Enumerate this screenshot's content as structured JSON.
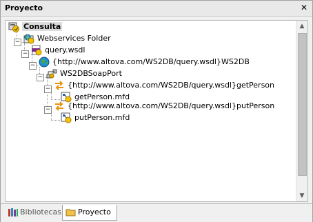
{
  "panel": {
    "title": "Proyecto",
    "close_glyph": "✕"
  },
  "tree": {
    "root": {
      "label": "Consulta",
      "icon": "project-icon"
    },
    "folder": {
      "label": "Webservices Folder",
      "icon": "webservices-folder-icon"
    },
    "wsdl": {
      "label": "query.wsdl",
      "icon": "wsdl-file-icon"
    },
    "service": {
      "label": "{http://www.altova.com/WS2DB/query.wsdl}WS2DB",
      "icon": "globe-service-icon"
    },
    "port": {
      "label": "WS2DBSoapPort",
      "icon": "soap-port-icon"
    },
    "operations": [
      {
        "label": "{http://www.altova.com/WS2DB/query.wsdl}getPerson",
        "icon": "operation-arrows-icon",
        "child": {
          "label": "getPerson.mfd",
          "icon": "mapping-file-icon"
        }
      },
      {
        "label": "{http://www.altova.com/WS2DB/query.wsdl}putPerson",
        "icon": "operation-arrows-icon",
        "child": {
          "label": "putPerson.mfd",
          "icon": "mapping-file-icon"
        }
      }
    ],
    "expand_glyph": "−"
  },
  "scrollbar": {
    "up_glyph": "▲",
    "down_glyph": "▼"
  },
  "tabs": [
    {
      "label": "Bibliotecas",
      "icon": "libraries-icon",
      "active": false
    },
    {
      "label": "Proyecto",
      "icon": "project-folder-icon",
      "active": true
    }
  ]
}
